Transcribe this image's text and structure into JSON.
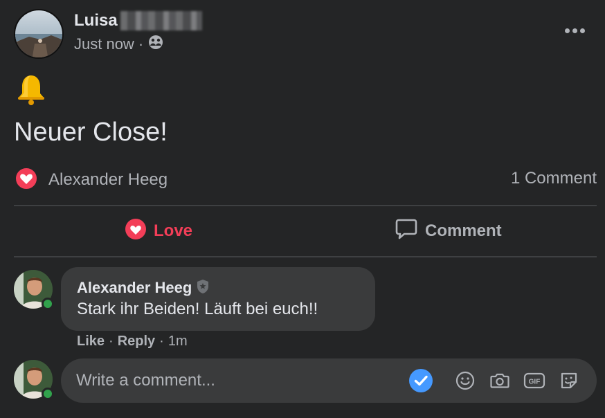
{
  "post": {
    "author_first_name": "Luisa",
    "timestamp": "Just now",
    "meta_separator": "·",
    "audience_icon": "friends-icon",
    "emoji": "🔔",
    "text": "Neuer Close!"
  },
  "reactions": {
    "reactor_name": "Alexander Heeg",
    "comment_count": "1 Comment"
  },
  "actions": {
    "love_label": "Love",
    "comment_label": "Comment"
  },
  "comment": {
    "author": "Alexander Heeg",
    "text": "Stark ihr Beiden! Läuft bei euch!!",
    "like_label": "Like",
    "reply_label": "Reply",
    "separator": "·",
    "time": "1m"
  },
  "composer": {
    "placeholder": "Write a comment...",
    "gif_label": "GIF"
  },
  "colors": {
    "background": "#242526",
    "love": "#f33e58",
    "online": "#31a24c",
    "check": "#4599ff"
  }
}
